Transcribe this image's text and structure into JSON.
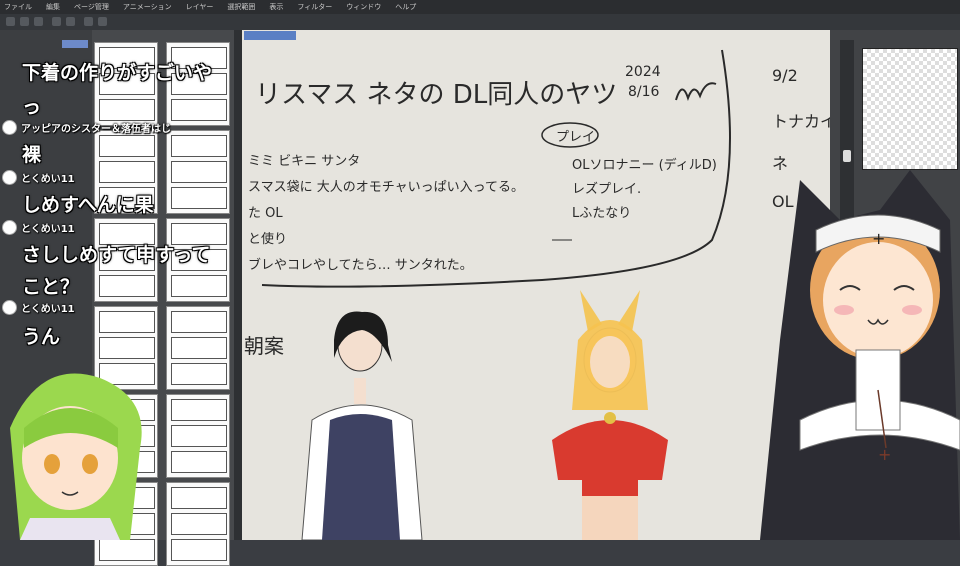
{
  "menu": [
    "ファイル",
    "編集",
    "ページ管理",
    "アニメーション",
    "レイヤー",
    "選択範囲",
    "表示",
    "フィルター",
    "ウィンドウ",
    "ヘルプ"
  ],
  "sketch": {
    "title": "リスマス ネタの DL同人のヤツ",
    "date_year": "2024",
    "date_md": "8/16",
    "notes": [
      "ミミ ビキニ サンタ",
      "スマス袋に 大人のオモチャいっぱい入ってる。",
      "た OL",
      "と使り",
      "ブレやコレやしてたら… サンタれた。"
    ],
    "play_label": "プレイ",
    "play_items": [
      "OLソロナニー (ディルD)",
      "レズプレイ.",
      "Lふたなり"
    ],
    "side_date": "9/2",
    "side_items": [
      "トナカイ",
      "ネ",
      "OL"
    ],
    "plan_label": "朝案"
  },
  "comments": [
    {
      "user": null,
      "text": "下着の作りがすごいや"
    },
    {
      "user": null,
      "text": "っ"
    },
    {
      "user": "アッピアのシスター＆落伍者はじ",
      "text": "裸"
    },
    {
      "user": "とくめい11",
      "text": "しめすへんに果"
    },
    {
      "user": "とくめい11",
      "text": "さししめすて申すって"
    },
    {
      "user": null,
      "text": "こと？"
    },
    {
      "user": "とくめい11",
      "text": "うん"
    }
  ],
  "colors": {
    "accent": "#5a7fc4",
    "canvas": "#e6e4de",
    "panel": "#47494c"
  }
}
